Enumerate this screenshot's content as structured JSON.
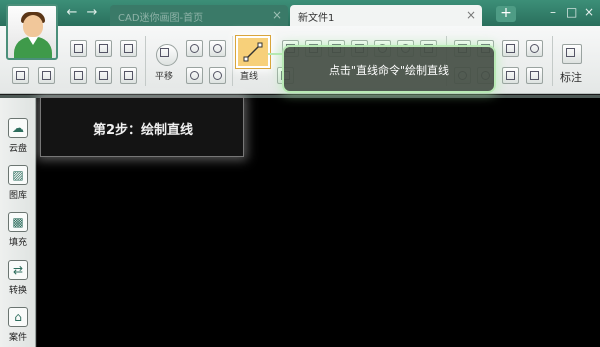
{
  "titlebar": {
    "tabs": [
      {
        "label": "CAD迷你画图-首页",
        "active": false
      },
      {
        "label": "新文件1",
        "active": true
      }
    ],
    "add_tab_label": "+",
    "close_glyph": "×",
    "back_icon": "←",
    "forward_icon": "→",
    "accent_color": "#3c8f78"
  },
  "ribbon": {
    "pan_label": "平移",
    "line_label": "直线",
    "annotate_label": "标注",
    "highlight_color": "#f7d07a"
  },
  "sidebar": {
    "items": [
      {
        "label": "云盘",
        "icon": "cloud-icon",
        "glyph": "☁"
      },
      {
        "label": "图库",
        "icon": "image-library-icon",
        "glyph": "▨"
      },
      {
        "label": "填充",
        "icon": "hatch-fill-icon",
        "glyph": "▩"
      },
      {
        "label": "转换",
        "icon": "convert-icon",
        "glyph": "⇄"
      },
      {
        "label": "案件",
        "icon": "case-icon",
        "glyph": "⌂"
      }
    ]
  },
  "callouts": {
    "step_text": "第2步：绘制直线",
    "tooltip_text": "点击\"直线命令\"绘制直线"
  }
}
